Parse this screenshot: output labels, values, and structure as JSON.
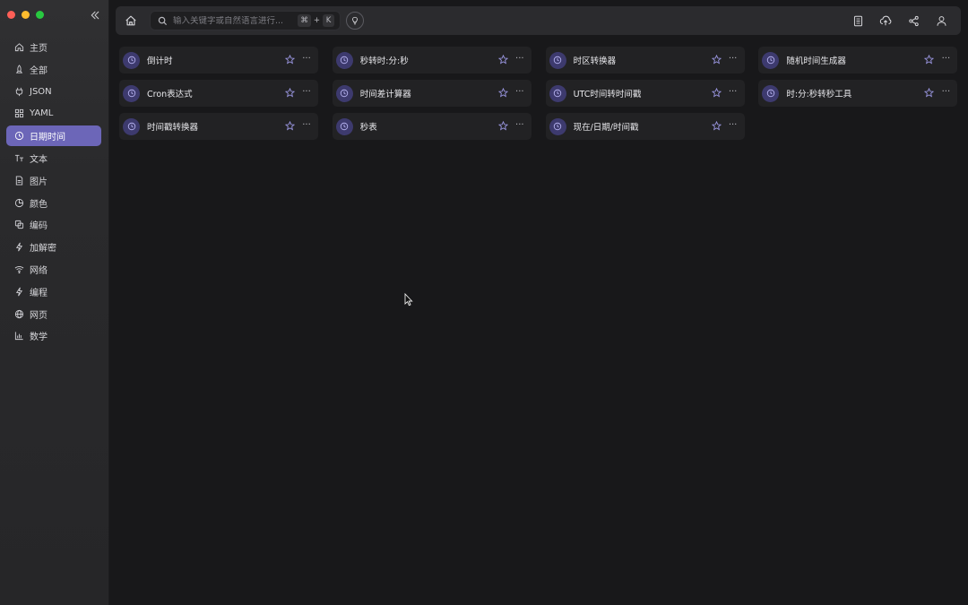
{
  "sidebar": {
    "items": [
      {
        "label": "主页",
        "icon": "home-icon",
        "active": false
      },
      {
        "label": "全部",
        "icon": "rocket-icon",
        "active": false
      },
      {
        "label": "JSON",
        "icon": "plug-icon",
        "active": false
      },
      {
        "label": "YAML",
        "icon": "grid-icon",
        "active": false
      },
      {
        "label": "日期时间",
        "icon": "clock-icon",
        "active": true
      },
      {
        "label": "文本",
        "icon": "text-icon",
        "active": false
      },
      {
        "label": "图片",
        "icon": "file-image-icon",
        "active": false
      },
      {
        "label": "颜色",
        "icon": "palette-icon",
        "active": false
      },
      {
        "label": "编码",
        "icon": "copy-icon",
        "active": false
      },
      {
        "label": "加解密",
        "icon": "bolt-icon",
        "active": false
      },
      {
        "label": "网络",
        "icon": "wifi-icon",
        "active": false
      },
      {
        "label": "编程",
        "icon": "code-bolt-icon",
        "active": false
      },
      {
        "label": "网页",
        "icon": "globe-icon",
        "active": false
      },
      {
        "label": "数学",
        "icon": "bar-chart-icon",
        "active": false
      }
    ]
  },
  "search": {
    "placeholder": "输入关键字或自然语言进行...",
    "shortcut_modifier": "⌘",
    "shortcut_plus": "+",
    "shortcut_key": "K"
  },
  "tools": [
    {
      "title": "倒计时"
    },
    {
      "title": "秒转时:分:秒"
    },
    {
      "title": "时区转换器"
    },
    {
      "title": "随机时间生成器"
    },
    {
      "title": "Cron表达式"
    },
    {
      "title": "时间差计算器"
    },
    {
      "title": "UTC时间转时间戳"
    },
    {
      "title": "时:分:秒转秒工具"
    },
    {
      "title": "时间戳转换器"
    },
    {
      "title": "秒表"
    },
    {
      "title": "现在/日期/时间戳"
    }
  ],
  "card_more_label": "···",
  "colors": {
    "accent": "#6c66b8",
    "card_icon_bg": "#3d3a6e",
    "background": "#18181a"
  }
}
